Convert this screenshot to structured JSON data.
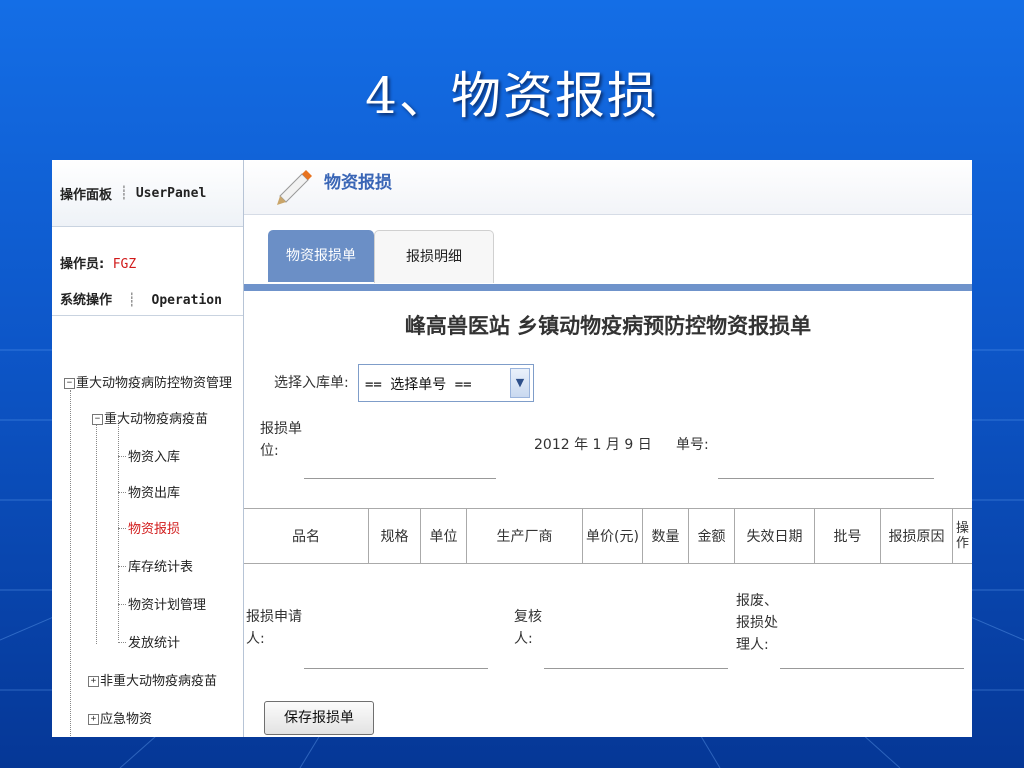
{
  "slide": {
    "title": "4、物资报损"
  },
  "sidebar": {
    "panel_label": "操作面板",
    "panel_label_en": "UserPanel",
    "operator_label": "操作员:",
    "operator_name": "FGZ",
    "system_label": "系统操作",
    "system_label_en": "Operation",
    "tree": {
      "root": "重大动物疫病防控物资管理",
      "group1": "重大动物疫病疫苗",
      "items": [
        "物资入库",
        "物资出库",
        "物资报损",
        "库存统计表",
        "物资计划管理",
        "发放统计"
      ],
      "active_item": "物资报损",
      "group2": "非重大动物疫病疫苗",
      "group3": "应急物资"
    }
  },
  "main": {
    "header_title": "物资报损",
    "tabs": [
      "物资报损单",
      "报损明细"
    ],
    "active_tab": "物资报损单",
    "form_title": "峰高兽医站 乡镇动物疫病预防控物资报损单",
    "select_label": "选择入库单:",
    "select_value": "== 选择单号 ==",
    "unit_label": "报损单位:",
    "date_text": "2012 年 1 月 9 日",
    "order_no_label": "单号:",
    "columns": [
      "品名",
      "规格",
      "单位",
      "生产厂商",
      "单价(元)",
      "数量",
      "金额",
      "失效日期",
      "批号",
      "报损原因",
      "操作"
    ],
    "applicant_label": "报损申请人:",
    "reviewer_label": "复核人:",
    "handler_label": "报废、报损处理人:",
    "save_button": "保存报损单"
  },
  "colors": {
    "slide_bg": "#0d56c8",
    "tab_active": "#6b8fc6",
    "active_tree_item": "#d11a1a",
    "operator_name": "#d11a1a"
  }
}
